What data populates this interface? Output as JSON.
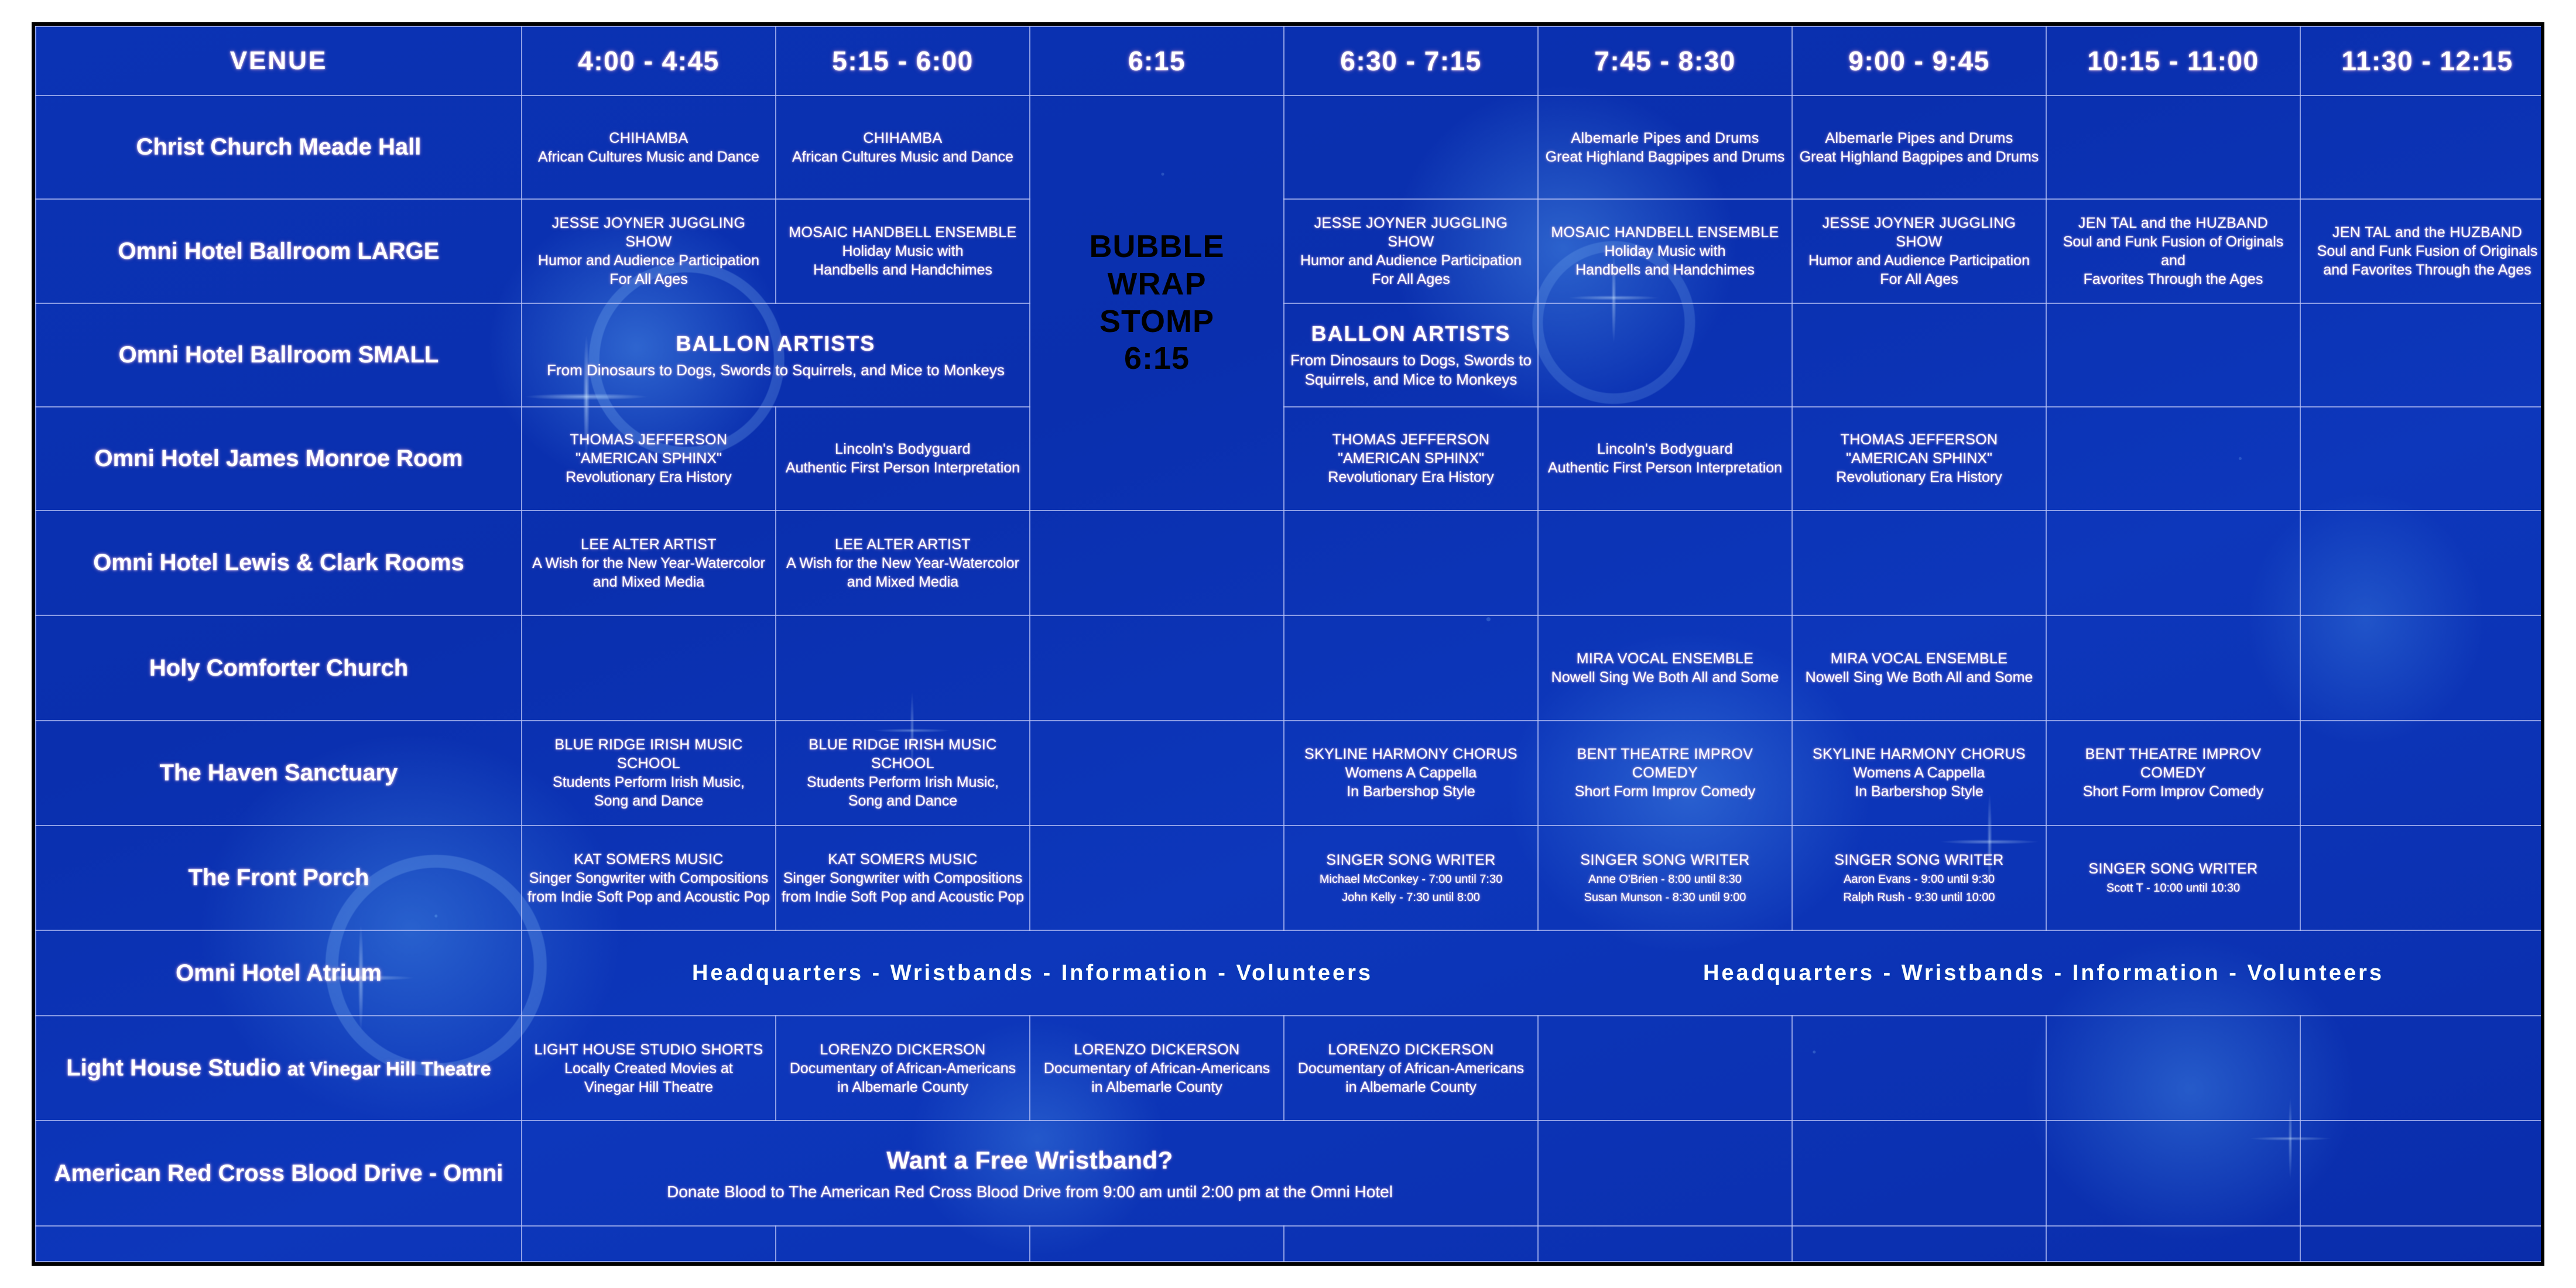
{
  "theme": {
    "background_blue": "#0b33b4",
    "accent_orange": "#f59000",
    "accent_cyan": "#00ffff",
    "text_white": "#ffffff",
    "frame_black": "#000000"
  },
  "header": {
    "venue_label": "VENUE",
    "times": [
      "4:00 - 4:45",
      "5:15 - 6:00",
      "6:15",
      "6:30 - 7:15",
      "7:45 - 8:30",
      "9:00 - 9:45",
      "10:15 - 11:00",
      "11:30 - 12:15"
    ]
  },
  "featured": {
    "line1": "BUBBLE",
    "line2": "WRAP",
    "line3": "STOMP",
    "line4": "6:15"
  },
  "venues": [
    {
      "name": "Christ Church Meade Hall"
    },
    {
      "name": "Omni Hotel Ballroom LARGE"
    },
    {
      "name": "Omni Hotel Ballroom SMALL"
    },
    {
      "name": "Omni Hotel James Monroe Room"
    },
    {
      "name": "Omni Hotel Lewis & Clark Rooms"
    },
    {
      "name": "Holy Comforter Church"
    },
    {
      "name": "The Haven Sanctuary"
    },
    {
      "name": "The Front Porch"
    },
    {
      "name": "Omni Hotel Atrium"
    },
    {
      "name": "Light House Studio",
      "name_small": "at Vinegar Hill Theatre"
    },
    {
      "name": "American Red Cross Blood Drive - Omni"
    }
  ],
  "rows": {
    "christ_church": [
      {
        "title": "CHIHAMBA",
        "sub1": "African Cultures Music and Dance"
      },
      {
        "title": "CHIHAMBA",
        "sub1": "African Cultures Music and Dance"
      },
      {},
      {},
      {
        "title": "Albemarle Pipes and Drums",
        "sub1": "Great Highland Bagpipes and Drums"
      },
      {
        "title": "Albemarle Pipes and Drums",
        "sub1": "Great Highland Bagpipes and Drums"
      },
      {},
      {}
    ],
    "ballroom_large": [
      {
        "title": "JESSE JOYNER JUGGLING SHOW",
        "sub1": "Humor and Audience Participation",
        "sub2": "For All Ages"
      },
      {
        "title": "MOSAIC HANDBELL ENSEMBLE",
        "sub1": "Holiday Music with",
        "sub2": "Handbells and Handchimes"
      },
      {},
      {
        "title": "JESSE JOYNER JUGGLING SHOW",
        "sub1": "Humor and Audience Participation",
        "sub2": "For All Ages"
      },
      {
        "title": "MOSAIC HANDBELL ENSEMBLE",
        "sub1": "Holiday Music with",
        "sub2": "Handbells and Handchimes"
      },
      {
        "title": "JESSE JOYNER JUGGLING SHOW",
        "sub1": "Humor and Audience Participation",
        "sub2": "For All Ages"
      },
      {
        "title": "JEN TAL and the HUZBAND",
        "sub1": "Soul and Funk Fusion of Originals and",
        "sub2": "Favorites Through the Ages"
      },
      {
        "title": "JEN TAL and the HUZBAND",
        "sub1": "Soul and Funk Fusion of Originals",
        "sub2": "and Favorites Through the Ages"
      }
    ],
    "ballroom_small": {
      "span_left": {
        "title": "BALLON ARTISTS",
        "sub1": "From Dinosaurs to Dogs, Swords to Squirrels, and Mice to Monkeys"
      },
      "after_bubble": {
        "title": "BALLON ARTISTS",
        "sub1": "From Dinosaurs to Dogs, Swords to",
        "sub2": "Squirrels, and Mice to Monkeys"
      }
    },
    "james_monroe": [
      {
        "title": "THOMAS JEFFERSON",
        "sub1": "\"AMERICAN SPHINX\"",
        "sub2": "Revolutionary Era History"
      },
      {
        "title": "Lincoln's Bodyguard",
        "sub1": "Authentic First Person Interpretation"
      },
      {},
      {
        "title": "THOMAS JEFFERSON",
        "sub1": "\"AMERICAN SPHINX\"",
        "sub2": "Revolutionary Era History"
      },
      {
        "title": "Lincoln's Bodyguard",
        "sub1": "Authentic First Person Interpretation"
      },
      {
        "title": "THOMAS JEFFERSON",
        "sub1": "\"AMERICAN SPHINX\"",
        "sub2": "Revolutionary Era History"
      },
      {},
      {}
    ],
    "lewis_clark": [
      {
        "title": "LEE ALTER ARTIST",
        "sub1": "A Wish for the New Year-Watercolor",
        "sub2": "and Mixed Media"
      },
      {
        "title": "LEE ALTER ARTIST",
        "sub1": "A Wish for the New Year-Watercolor",
        "sub2": "and Mixed Media"
      },
      {},
      {},
      {},
      {},
      {},
      {}
    ],
    "holy_comforter": [
      {},
      {},
      {},
      {},
      {
        "title": "MIRA VOCAL ENSEMBLE",
        "sub1": "Nowell Sing We Both All and Some"
      },
      {
        "title": "MIRA VOCAL ENSEMBLE",
        "sub1": "Nowell Sing We Both All and Some"
      },
      {},
      {}
    ],
    "haven_sanctuary": [
      {
        "title": "BLUE RIDGE IRISH MUSIC SCHOOL",
        "sub1": "Students Perform Irish Music,",
        "sub2": "Song and Dance"
      },
      {
        "title": "BLUE RIDGE IRISH MUSIC SCHOOL",
        "sub1": "Students Perform Irish Music,",
        "sub2": "Song and Dance"
      },
      {},
      {
        "title": "SKYLINE HARMONY CHORUS",
        "sub1": "Womens A Cappella",
        "sub2": "In Barbershop Style"
      },
      {
        "title": "BENT THEATRE IMPROV COMEDY",
        "sub1": "Short Form Improv Comedy"
      },
      {
        "title": "SKYLINE HARMONY CHORUS",
        "sub1": "Womens A Cappella",
        "sub2": "In Barbershop Style"
      },
      {
        "title": "BENT THEATRE IMPROV COMEDY",
        "sub1": "Short Form Improv Comedy"
      },
      {}
    ],
    "front_porch": [
      {
        "title": "KAT SOMERS MUSIC",
        "sub1": "Singer Songwriter with Compositions",
        "sub2": "from Indie Soft Pop and Acoustic Pop"
      },
      {
        "title": "KAT SOMERS MUSIC",
        "sub1": "Singer Songwriter with Compositions",
        "sub2": "from Indie Soft Pop and Acoustic Pop"
      },
      {},
      {
        "title": "SINGER SONG WRITER",
        "tiny1": "Michael McConkey  -  7:00 until 7:30",
        "tiny2": "John Kelly  -  7:30 until 8:00"
      },
      {
        "title": "SINGER SONG WRITER",
        "tiny1": "Anne O'Brien  -  8:00 until 8:30",
        "tiny2": "Susan Munson  -  8:30 until 9:00"
      },
      {
        "title": "SINGER SONG WRITER",
        "tiny1": "Aaron Evans  -  9:00 until 9:30",
        "tiny2": "Ralph Rush  -  9:30 until 10:00"
      },
      {
        "title": "SINGER SONG WRITER",
        "tiny1": "Scott T  -  10:00 until 10:30"
      },
      {}
    ],
    "atrium_banner": {
      "text_left": "Headquarters  -  Wristbands  -  Information  -  Volunteers",
      "text_right": "Headquarters  -  Wristbands  -  Information  -  Volunteers"
    },
    "light_house": [
      {
        "title": "LIGHT HOUSE STUDIO SHORTS",
        "sub1": "Locally Created Movies at",
        "sub2": "Vinegar Hill Theatre"
      },
      {
        "title": "LORENZO DICKERSON",
        "sub1": "Documentary of African-Americans",
        "sub2": "in Albemarle County"
      },
      {
        "title": "LORENZO DICKERSON",
        "sub1": "Documentary of African-Americans",
        "sub2": "in Albemarle County"
      },
      {
        "title": "LORENZO DICKERSON",
        "sub1": "Documentary of African-Americans",
        "sub2": "in Albemarle County"
      },
      {},
      {},
      {},
      {}
    ],
    "blood_drive": {
      "title": "Want a Free Wristband?",
      "sub": "Donate Blood to The American Red Cross Blood Drive from 9:00 am until 2:00 pm at the Omni Hotel"
    }
  }
}
